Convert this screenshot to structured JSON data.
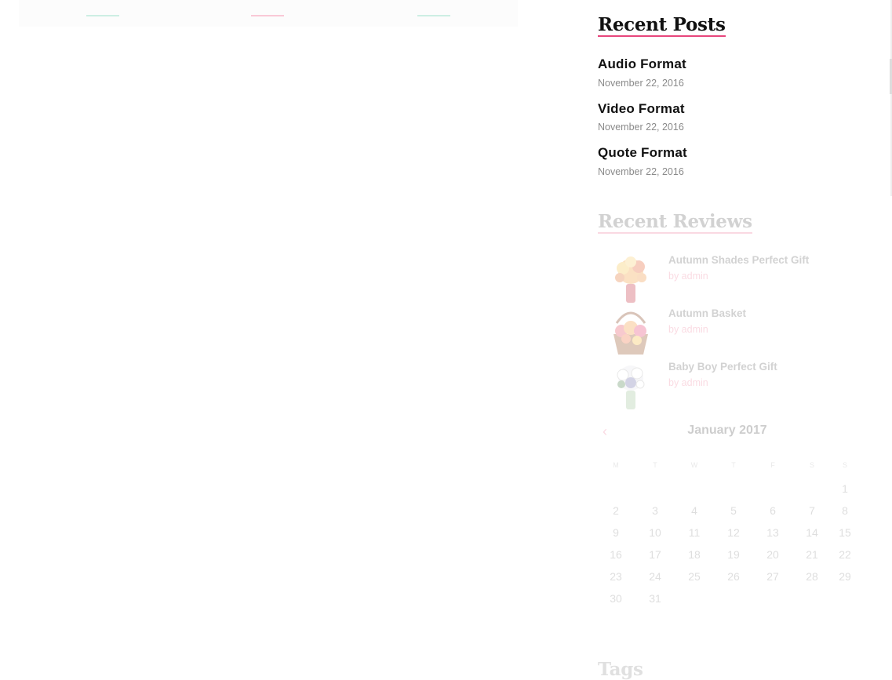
{
  "recent_posts": {
    "title": "Recent Posts",
    "items": [
      {
        "title": "Audio Format",
        "date": "November 22, 2016"
      },
      {
        "title": "Video Format",
        "date": "November 22, 2016"
      },
      {
        "title": "Quote Format",
        "date": "November 22, 2016"
      }
    ]
  },
  "recent_reviews": {
    "title": "Recent Reviews",
    "items": [
      {
        "title": "Autumn Shades Perfect Gift",
        "byline": "by admin"
      },
      {
        "title": "Autumn Basket",
        "byline": "by admin"
      },
      {
        "title": "Baby Boy Perfect Gift",
        "byline": "by admin"
      }
    ]
  },
  "calendar": {
    "title": "January 2017",
    "prev_label": "‹",
    "weekday_headers": [
      "M",
      "T",
      "W",
      "T",
      "F",
      "S",
      "S"
    ],
    "weeks": [
      [
        "",
        "",
        "",
        "",
        "",
        "",
        "1"
      ],
      [
        "2",
        "3",
        "4",
        "5",
        "6",
        "7",
        "8"
      ],
      [
        "9",
        "10",
        "11",
        "12",
        "13",
        "14",
        "15"
      ],
      [
        "16",
        "17",
        "18",
        "19",
        "20",
        "21",
        "22"
      ],
      [
        "23",
        "24",
        "25",
        "26",
        "27",
        "28",
        "29"
      ],
      [
        "30",
        "31",
        "",
        "",
        "",
        "",
        ""
      ]
    ]
  },
  "tags": {
    "title": "Tags"
  },
  "colors": {
    "accent_pink": "#e8467c",
    "accent_mint": "#8fd9c0"
  }
}
